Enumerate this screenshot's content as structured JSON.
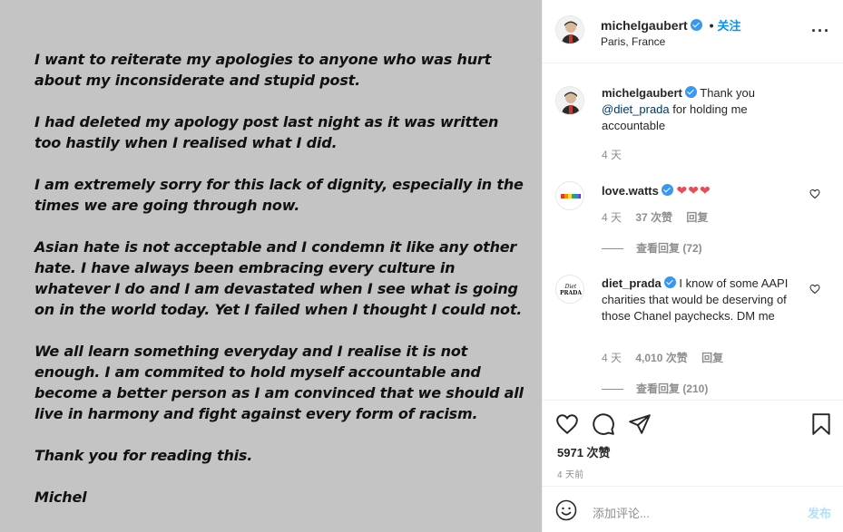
{
  "post": {
    "paragraphs": [
      "I want to reiterate my apologies to anyone who was hurt about my inconsiderate and stupid post.",
      "I had deleted my apology post last night as it was written too hastily when I realised what I did.",
      "I am extremely sorry for this lack of dignity, especially in the times we are going through now.",
      "Asian hate is not acceptable and I condemn it like any other hate. I have always been embracing  every culture in whatever I do and  I am devastated when I see what is going on in the world today. Yet I failed when I thought I could not.",
      "We all learn something everyday and I realise it is not enough. I am commited to hold myself accountable and become a better person as I am convinced that we should all live in harmony and fight against every form of racism.",
      "Thank you for reading this.",
      "Michel"
    ]
  },
  "header": {
    "username": "michelgaubert",
    "separator": "•",
    "follow_label": "关注",
    "location": "Paris, France",
    "more_icon": "more-horizontal-icon",
    "more_label": "···"
  },
  "comments": [
    {
      "username": "michelgaubert",
      "text_before": "Thank you",
      "mention": "@diet_prada",
      "text_after": "for holding me accountable",
      "time": "4 天"
    },
    {
      "username": "love.watts",
      "text": "❤❤❤",
      "time": "4 天",
      "likes": "37 次赞",
      "reply": "回复",
      "view_replies": "查看回复 (72)"
    },
    {
      "username": "diet_prada",
      "text": "I know of some AAPI charities that would be deserving of those Chanel paychecks. DM me",
      "time": "4 天",
      "likes": "4,010 次赞",
      "reply": "回复",
      "view_replies": "查看回复 (210)",
      "avatar_text": "PRADA"
    }
  ],
  "actions": {
    "likes": "5971 次赞",
    "age": "4 天前"
  },
  "add_comment": {
    "placeholder": "添加评论...",
    "post_label": "发布"
  },
  "colors": {
    "accent": "#0095f6",
    "heart": "#ed4956",
    "image_bg": "#c4c4c4"
  }
}
